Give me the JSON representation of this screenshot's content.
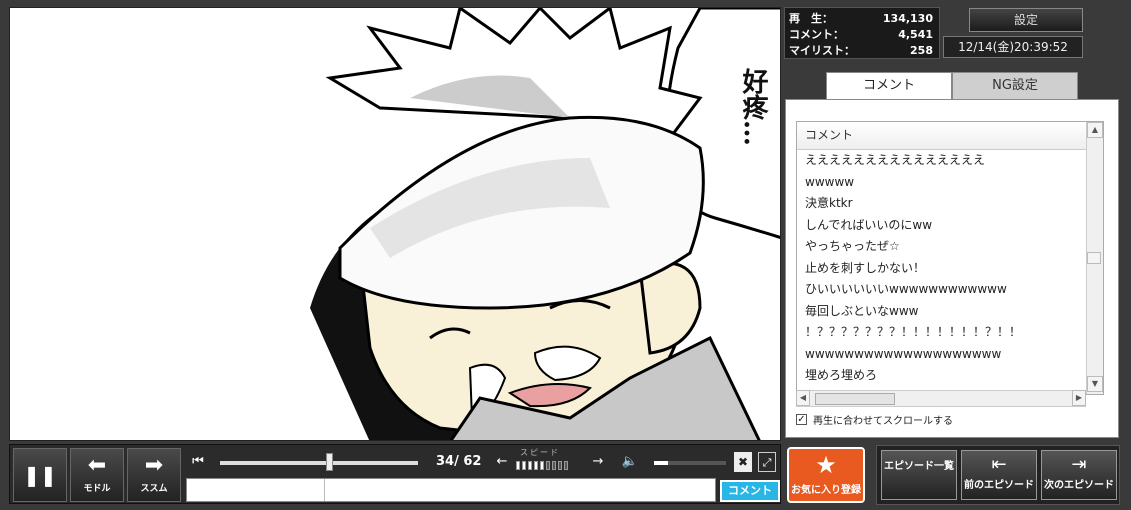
{
  "video": {
    "speech_text": "好疼…"
  },
  "stats": {
    "rows": [
      {
        "label": "再　生：",
        "value": "134,130"
      },
      {
        "label": "コメント：",
        "value": "4,541"
      },
      {
        "label": "マイリスト：",
        "value": "258"
      }
    ]
  },
  "header": {
    "settings_label": "設定",
    "date": "12/14(金)20:39:52"
  },
  "tabs": [
    {
      "label": "コメント",
      "active": true
    },
    {
      "label": "NG設定",
      "active": false
    }
  ],
  "comments": {
    "header": "コメント",
    "items": [
      "えええええええええええええええ",
      "wwwww",
      "決意ktkr",
      "しんでればいいのにww",
      "やっちゃったぜ☆",
      "止めを刺すしかない！",
      "ひいいいいいいwwwwwwwwwwww",
      "毎回しぶといなwww",
      "！？？？？？？？！！！！！！！？！！",
      "wwwwwwwwwwwwwwwwwwww",
      "埋めろ埋めろ"
    ],
    "autoscroll_label": "再生に合わせてスクロールする",
    "autoscroll_checked": true
  },
  "player": {
    "buttons": {
      "pause_glyph": "❚❚",
      "back_label": "モドル",
      "forward_label": "ススム"
    },
    "time": "34/ 62",
    "progress": 0.55,
    "speed_label": "スピード",
    "speed_level": 5,
    "speed_max": 9,
    "volume": 0.2,
    "comment_submit_label": "コメント"
  },
  "actions": {
    "favorite_label": "お気に入り登録",
    "episode_list_label": "エピソード一覧",
    "prev_label": "前のエピソード",
    "next_label": "次のエピソード"
  },
  "colors": {
    "accent_orange": "#e85a20",
    "submit_blue": "#29b6e6"
  }
}
